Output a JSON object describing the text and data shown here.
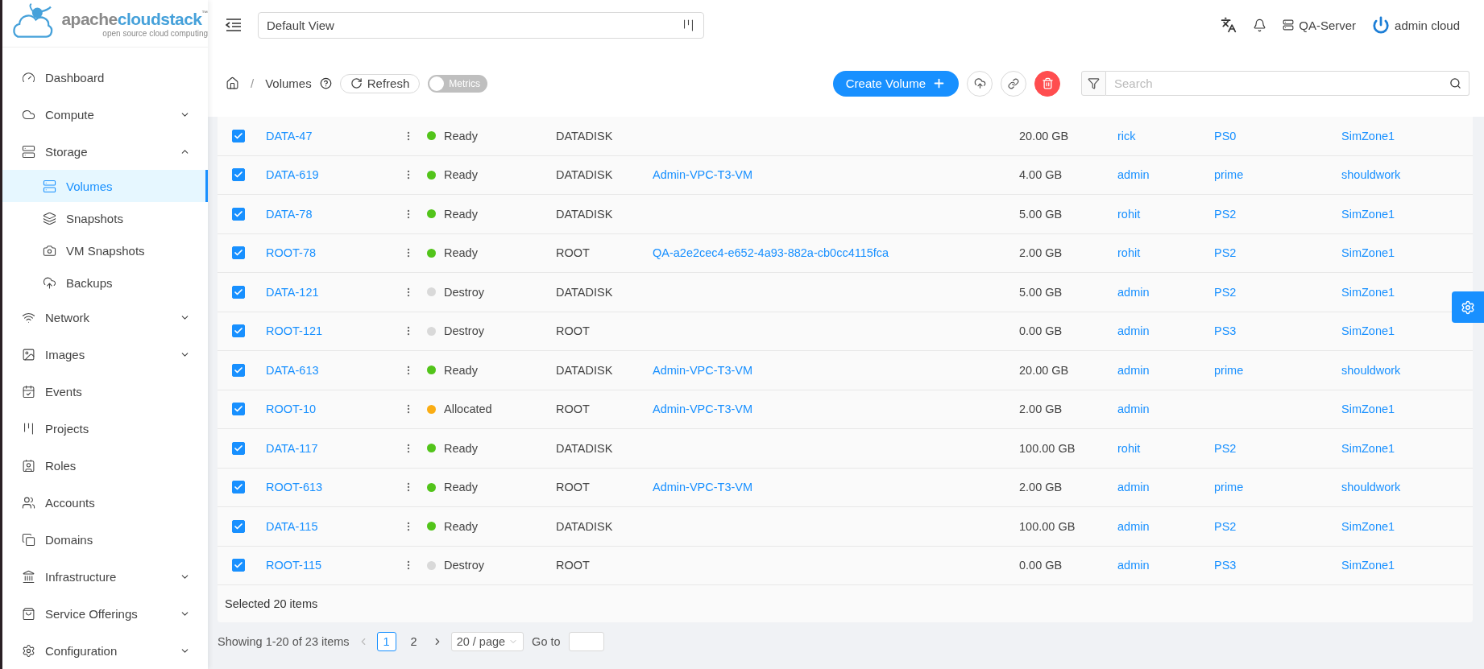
{
  "logo": {
    "prefix": "apache",
    "suffix": "cloudstack",
    "trademark": "™",
    "tagline": "open source cloud computing"
  },
  "sidebar": {
    "items": [
      {
        "label": "Dashboard",
        "kind": "dashboard",
        "selected": false
      },
      {
        "label": "Compute",
        "kind": "compute",
        "expanded": false,
        "selected": false
      },
      {
        "label": "Storage",
        "kind": "storage",
        "expanded": true,
        "selected": false,
        "children": [
          {
            "label": "Volumes",
            "kind": "volumes",
            "selected": true
          },
          {
            "label": "Snapshots",
            "kind": "snapshots",
            "selected": false
          },
          {
            "label": "VM Snapshots",
            "kind": "camera",
            "selected": false
          },
          {
            "label": "Backups",
            "kind": "backups",
            "selected": false
          }
        ]
      },
      {
        "label": "Network",
        "kind": "network",
        "expanded": false,
        "selected": false
      },
      {
        "label": "Images",
        "kind": "images",
        "expanded": false,
        "selected": false
      },
      {
        "label": "Events",
        "kind": "events",
        "selected": false
      },
      {
        "label": "Projects",
        "kind": "projects",
        "selected": false
      },
      {
        "label": "Roles",
        "kind": "roles",
        "selected": false
      },
      {
        "label": "Accounts",
        "kind": "accounts",
        "selected": false
      },
      {
        "label": "Domains",
        "kind": "domains",
        "selected": false
      },
      {
        "label": "Infrastructure",
        "kind": "infrastructure",
        "expanded": false,
        "selected": false
      },
      {
        "label": "Service Offerings",
        "kind": "offerings",
        "expanded": false,
        "selected": false
      },
      {
        "label": "Configuration",
        "kind": "configuration",
        "expanded": false,
        "selected": false
      }
    ]
  },
  "header": {
    "view_select": "Default View",
    "server": "QA-Server",
    "user": "admin cloud"
  },
  "toolbar": {
    "separator": "/",
    "breadcrumb": "Volumes",
    "refresh": "Refresh",
    "metrics": {
      "label": "Metrics",
      "on": false
    },
    "create": "Create Volume",
    "search": {
      "placeholder": "Search"
    }
  },
  "table": {
    "rows": [
      {
        "name": "DATA-47",
        "checked": true,
        "state": "Ready",
        "color": "#52c41a",
        "type": "DATADISK",
        "size": "20.00 GB",
        "account": "rick",
        "storage": "PS0",
        "zone": "SimZone1"
      },
      {
        "name": "DATA-619",
        "checked": true,
        "state": "Ready",
        "color": "#52c41a",
        "type": "DATADISK",
        "vm": "Admin-VPC-T3-VM",
        "size": "4.00 GB",
        "account": "admin",
        "storage": "prime",
        "zone": "shouldwork"
      },
      {
        "name": "DATA-78",
        "checked": true,
        "state": "Ready",
        "color": "#52c41a",
        "type": "DATADISK",
        "size": "5.00 GB",
        "account": "rohit",
        "storage": "PS2",
        "zone": "SimZone1"
      },
      {
        "name": "ROOT-78",
        "checked": true,
        "state": "Ready",
        "color": "#52c41a",
        "type": "ROOT",
        "vm": "QA-a2e2cec4-e652-4a93-882a-cb0cc4115fca",
        "size": "2.00 GB",
        "account": "rohit",
        "storage": "PS2",
        "zone": "SimZone1"
      },
      {
        "name": "DATA-121",
        "checked": true,
        "state": "Destroy",
        "color": "#d9d9d9",
        "type": "DATADISK",
        "size": "5.00 GB",
        "account": "admin",
        "storage": "PS2",
        "zone": "SimZone1"
      },
      {
        "name": "ROOT-121",
        "checked": true,
        "state": "Destroy",
        "color": "#d9d9d9",
        "type": "ROOT",
        "size": "0.00 GB",
        "account": "admin",
        "storage": "PS3",
        "zone": "SimZone1"
      },
      {
        "name": "DATA-613",
        "checked": true,
        "state": "Ready",
        "color": "#52c41a",
        "type": "DATADISK",
        "vm": "Admin-VPC-T3-VM",
        "size": "20.00 GB",
        "account": "admin",
        "storage": "prime",
        "zone": "shouldwork"
      },
      {
        "name": "ROOT-10",
        "checked": true,
        "state": "Allocated",
        "color": "#faad14",
        "type": "ROOT",
        "vm": "Admin-VPC-T3-VM",
        "size": "2.00 GB",
        "account": "admin",
        "zone": "SimZone1"
      },
      {
        "name": "DATA-117",
        "checked": true,
        "state": "Ready",
        "color": "#52c41a",
        "type": "DATADISK",
        "size": "100.00 GB",
        "account": "rohit",
        "storage": "PS2",
        "zone": "SimZone1"
      },
      {
        "name": "ROOT-613",
        "checked": true,
        "state": "Ready",
        "color": "#52c41a",
        "type": "ROOT",
        "vm": "Admin-VPC-T3-VM",
        "size": "2.00 GB",
        "account": "admin",
        "storage": "prime",
        "zone": "shouldwork"
      },
      {
        "name": "DATA-115",
        "checked": true,
        "state": "Ready",
        "color": "#52c41a",
        "type": "DATADISK",
        "size": "100.00 GB",
        "account": "admin",
        "storage": "PS2",
        "zone": "SimZone1"
      },
      {
        "name": "ROOT-115",
        "checked": true,
        "state": "Destroy",
        "color": "#d9d9d9",
        "type": "ROOT",
        "size": "0.00 GB",
        "account": "admin",
        "storage": "PS3",
        "zone": "SimZone1"
      }
    ],
    "selection_note": "Selected 20 items"
  },
  "pagination": {
    "summary": "Showing 1-20 of 23 items",
    "pages": [
      {
        "label": "1",
        "selected": true
      },
      {
        "label": "2",
        "selected": false
      }
    ],
    "page_size": "20 / page",
    "goto": "Go to"
  }
}
